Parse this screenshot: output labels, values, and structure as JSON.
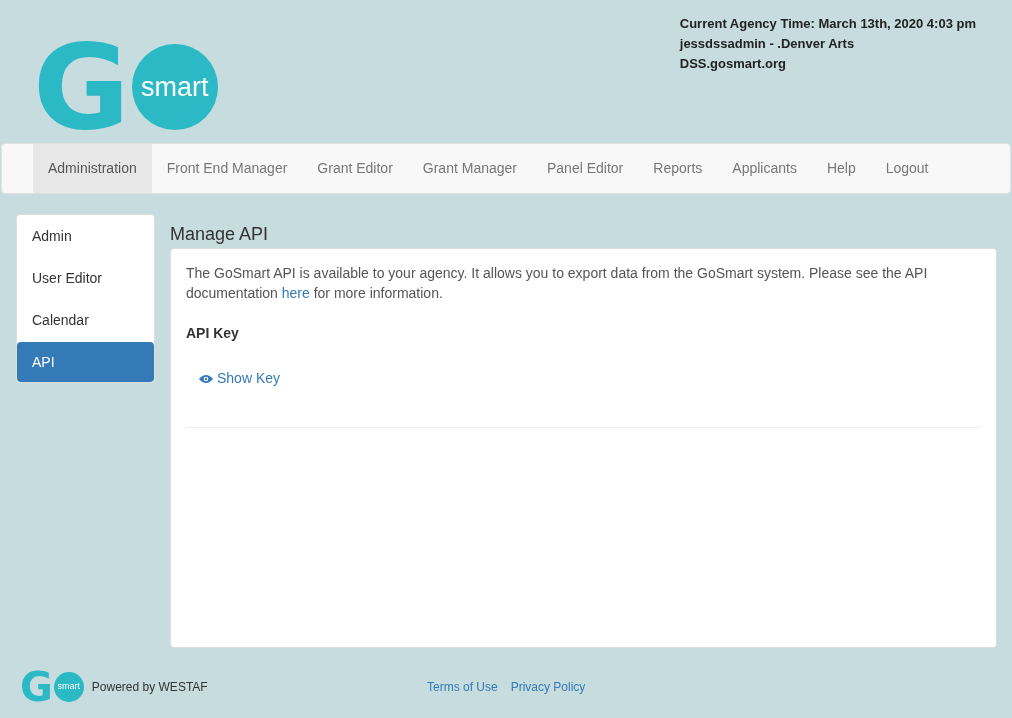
{
  "logo": {
    "letter": "G",
    "word": "smart"
  },
  "header_info": [
    "Current Agency Time: March 13th, 2020 4:03 pm",
    "jessdssadmin - .Denver Arts",
    "DSS.gosmart.org"
  ],
  "nav": [
    {
      "label": "Administration",
      "selected": true
    },
    {
      "label": "Front End Manager",
      "selected": false
    },
    {
      "label": "Grant Editor",
      "selected": false
    },
    {
      "label": "Grant Manager",
      "selected": false
    },
    {
      "label": "Panel Editor",
      "selected": false
    },
    {
      "label": "Reports",
      "selected": false
    },
    {
      "label": "Applicants",
      "selected": false
    },
    {
      "label": "Help",
      "selected": false
    },
    {
      "label": "Logout",
      "selected": false
    }
  ],
  "sidebar": [
    {
      "label": "Admin",
      "selected": false
    },
    {
      "label": "User Editor",
      "selected": false
    },
    {
      "label": "Calendar",
      "selected": false
    },
    {
      "label": "API",
      "selected": true
    }
  ],
  "page_title": "Manage API",
  "intro": {
    "before": "The GoSmart API is available to your agency. It allows you to export data from the GoSmart system. Please see the API documentation",
    "link": "here",
    "after": "for more information."
  },
  "api_key_label": "API Key",
  "show_key": "Show Key",
  "footer": {
    "logo_letter": "G",
    "logo_word": "smart",
    "powered_by": "Powered by WESTAF",
    "links": [
      "Terms of Use",
      "Privacy Policy"
    ]
  }
}
